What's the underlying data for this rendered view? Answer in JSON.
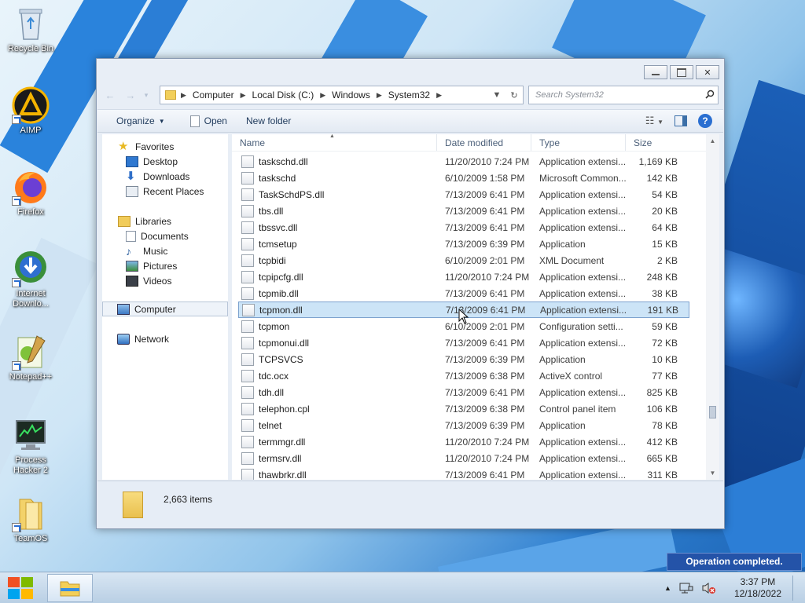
{
  "desktop": {
    "icons": [
      {
        "label": "Recycle Bin"
      },
      {
        "label": "AIMP"
      },
      {
        "label": "Firefox"
      },
      {
        "label": "Internet Downlo..."
      },
      {
        "label": "Notepad++"
      },
      {
        "label": "Process Hacker 2"
      },
      {
        "label": "TeamOS"
      }
    ]
  },
  "window": {
    "caption_buttons": {
      "close": "✕"
    },
    "nav": {
      "back": "←",
      "forward": "→",
      "dropdown": "▾"
    },
    "breadcrumb": [
      "Computer",
      "Local Disk (C:)",
      "Windows",
      "System32"
    ],
    "search_placeholder": "Search System32",
    "toolbar": {
      "organize": "Organize",
      "open": "Open",
      "new_folder": "New folder",
      "help": "?"
    },
    "navpane": {
      "favorites": "Favorites",
      "fav_items": [
        "Desktop",
        "Downloads",
        "Recent Places"
      ],
      "libraries": "Libraries",
      "lib_items": [
        "Documents",
        "Music",
        "Pictures",
        "Videos"
      ],
      "computer": "Computer",
      "network": "Network"
    },
    "columns": {
      "name": "Name",
      "date": "Date modified",
      "type": "Type",
      "size": "Size"
    },
    "files": [
      {
        "name": "taskschd.dll",
        "date": "11/20/2010 7:24 PM",
        "type": "Application extensi...",
        "size": "1,169 KB"
      },
      {
        "name": "taskschd",
        "date": "6/10/2009 1:58 PM",
        "type": "Microsoft Common...",
        "size": "142 KB"
      },
      {
        "name": "TaskSchdPS.dll",
        "date": "7/13/2009 6:41 PM",
        "type": "Application extensi...",
        "size": "54 KB"
      },
      {
        "name": "tbs.dll",
        "date": "7/13/2009 6:41 PM",
        "type": "Application extensi...",
        "size": "20 KB"
      },
      {
        "name": "tbssvc.dll",
        "date": "7/13/2009 6:41 PM",
        "type": "Application extensi...",
        "size": "64 KB"
      },
      {
        "name": "tcmsetup",
        "date": "7/13/2009 6:39 PM",
        "type": "Application",
        "size": "15 KB"
      },
      {
        "name": "tcpbidi",
        "date": "6/10/2009 2:01 PM",
        "type": "XML Document",
        "size": "2 KB"
      },
      {
        "name": "tcpipcfg.dll",
        "date": "11/20/2010 7:24 PM",
        "type": "Application extensi...",
        "size": "248 KB"
      },
      {
        "name": "tcpmib.dll",
        "date": "7/13/2009 6:41 PM",
        "type": "Application extensi...",
        "size": "38 KB"
      },
      {
        "name": "tcpmon.dll",
        "date": "7/13/2009 6:41 PM",
        "type": "Application extensi...",
        "size": "191 KB",
        "selected": true
      },
      {
        "name": "tcpmon",
        "date": "6/10/2009 2:01 PM",
        "type": "Configuration setti...",
        "size": "59 KB"
      },
      {
        "name": "tcpmonui.dll",
        "date": "7/13/2009 6:41 PM",
        "type": "Application extensi...",
        "size": "72 KB"
      },
      {
        "name": "TCPSVCS",
        "date": "7/13/2009 6:39 PM",
        "type": "Application",
        "size": "10 KB"
      },
      {
        "name": "tdc.ocx",
        "date": "7/13/2009 6:38 PM",
        "type": "ActiveX control",
        "size": "77 KB"
      },
      {
        "name": "tdh.dll",
        "date": "7/13/2009 6:41 PM",
        "type": "Application extensi...",
        "size": "825 KB"
      },
      {
        "name": "telephon.cpl",
        "date": "7/13/2009 6:38 PM",
        "type": "Control panel item",
        "size": "106 KB"
      },
      {
        "name": "telnet",
        "date": "7/13/2009 6:39 PM",
        "type": "Application",
        "size": "78 KB"
      },
      {
        "name": "termmgr.dll",
        "date": "11/20/2010 7:24 PM",
        "type": "Application extensi...",
        "size": "412 KB"
      },
      {
        "name": "termsrv.dll",
        "date": "11/20/2010 7:24 PM",
        "type": "Application extensi...",
        "size": "665 KB"
      },
      {
        "name": "thawbrkr.dll",
        "date": "7/13/2009 6:41 PM",
        "type": "Application extensi...",
        "size": "311 KB"
      }
    ],
    "details": {
      "item_count": "2,663 items"
    }
  },
  "taskbar": {
    "time": "3:37 PM",
    "date": "12/18/2022",
    "notification": "Operation completed."
  },
  "colors": {
    "selection": "#cce4f7",
    "accent": "#2a6fd1",
    "toast": "#2453a8"
  }
}
